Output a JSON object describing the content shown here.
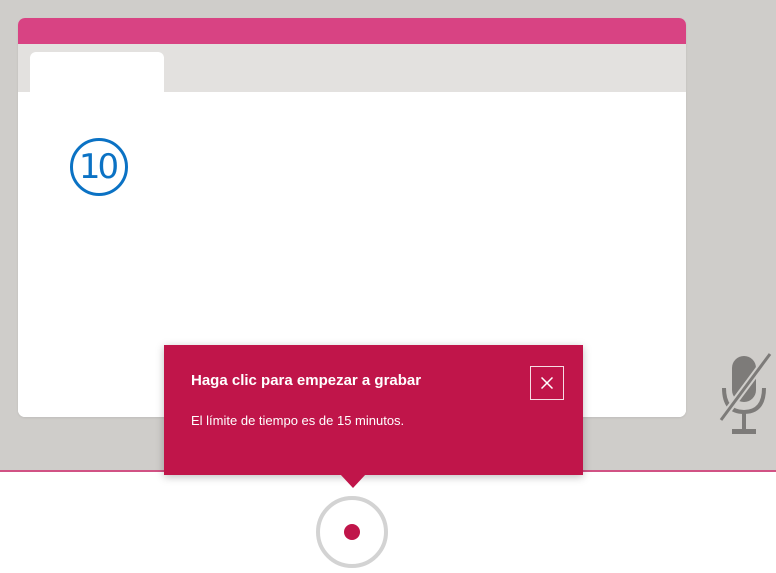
{
  "step_marker": {
    "number": "10"
  },
  "tooltip": {
    "title": "Haga clic para empezar a grabar",
    "body": "El límite de tiempo es de 15 minutos.",
    "close_icon": "close-x-icon"
  },
  "controls": {
    "record_icon": "record-dot-icon",
    "mic_icon": "microphone-muted-icon"
  },
  "colors": {
    "accent": "#c0154a",
    "window_title_bar": "#d84383",
    "step_marker": "#0b72c4",
    "background_gray": "#cfcdca"
  }
}
